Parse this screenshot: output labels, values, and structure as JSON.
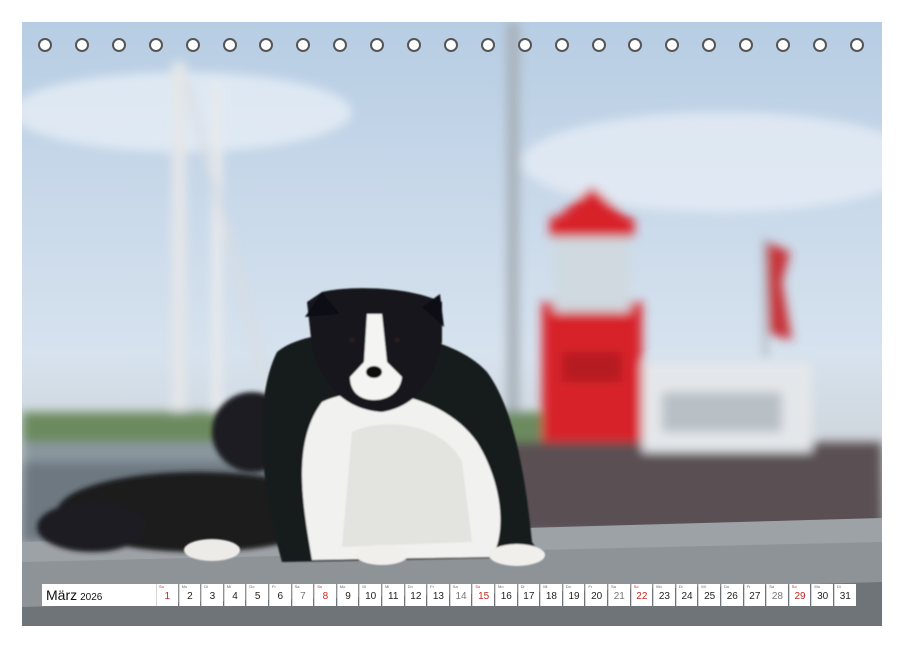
{
  "calendar": {
    "month": "März",
    "year": "2026",
    "days": [
      {
        "wd": "So",
        "n": "1",
        "type": "sun"
      },
      {
        "wd": "Mo",
        "n": "2",
        "type": ""
      },
      {
        "wd": "Di",
        "n": "3",
        "type": ""
      },
      {
        "wd": "Mi",
        "n": "4",
        "type": ""
      },
      {
        "wd": "Do",
        "n": "5",
        "type": ""
      },
      {
        "wd": "Fr",
        "n": "6",
        "type": ""
      },
      {
        "wd": "Sa",
        "n": "7",
        "type": "sat"
      },
      {
        "wd": "So",
        "n": "8",
        "type": "sun"
      },
      {
        "wd": "Mo",
        "n": "9",
        "type": ""
      },
      {
        "wd": "Di",
        "n": "10",
        "type": ""
      },
      {
        "wd": "Mi",
        "n": "11",
        "type": ""
      },
      {
        "wd": "Do",
        "n": "12",
        "type": ""
      },
      {
        "wd": "Fr",
        "n": "13",
        "type": ""
      },
      {
        "wd": "Sa",
        "n": "14",
        "type": "sat"
      },
      {
        "wd": "So",
        "n": "15",
        "type": "sun"
      },
      {
        "wd": "Mo",
        "n": "16",
        "type": ""
      },
      {
        "wd": "Di",
        "n": "17",
        "type": ""
      },
      {
        "wd": "Mi",
        "n": "18",
        "type": ""
      },
      {
        "wd": "Do",
        "n": "19",
        "type": ""
      },
      {
        "wd": "Fr",
        "n": "20",
        "type": ""
      },
      {
        "wd": "Sa",
        "n": "21",
        "type": "sat"
      },
      {
        "wd": "So",
        "n": "22",
        "type": "sun"
      },
      {
        "wd": "Mo",
        "n": "23",
        "type": ""
      },
      {
        "wd": "Di",
        "n": "24",
        "type": ""
      },
      {
        "wd": "Mi",
        "n": "25",
        "type": ""
      },
      {
        "wd": "Do",
        "n": "26",
        "type": ""
      },
      {
        "wd": "Fr",
        "n": "27",
        "type": ""
      },
      {
        "wd": "Sa",
        "n": "28",
        "type": "sat"
      },
      {
        "wd": "So",
        "n": "29",
        "type": "sun"
      },
      {
        "wd": "Mo",
        "n": "30",
        "type": ""
      },
      {
        "wd": "Di",
        "n": "31",
        "type": ""
      }
    ]
  },
  "colors": {
    "sunday": "#c42a22",
    "lighthouse": "#d8232a",
    "dog_black": "#151518",
    "dog_white": "#f1f1ef"
  },
  "icons": [
    "binding-hole-icon"
  ]
}
